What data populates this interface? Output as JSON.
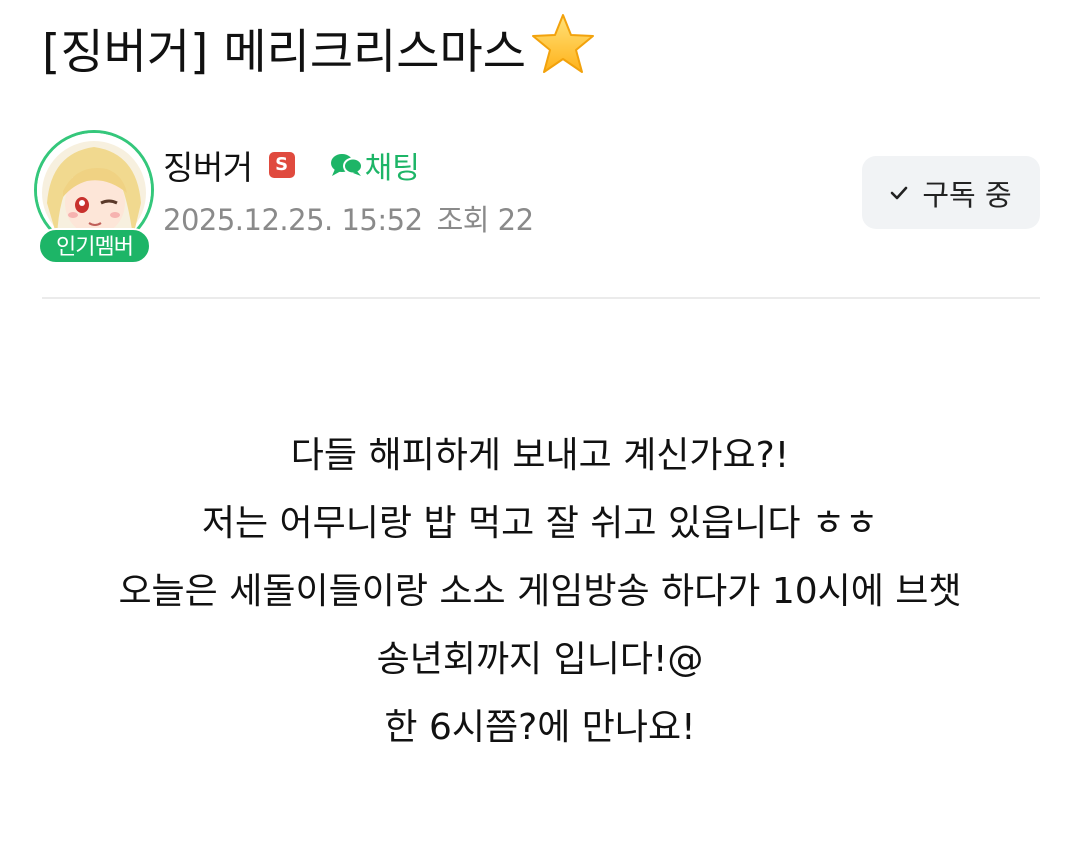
{
  "post": {
    "title": "[징버거] 메리크리스마스",
    "author": {
      "name": "징버거",
      "badge": "인기멤버",
      "level_icon": "S",
      "chat_label": "채팅"
    },
    "date": "2025.12.25. 15:52",
    "views": "조회 22",
    "subscribe_label": "구독 중",
    "body_lines": [
      "다들 해피하게 보내고 계신가요?!",
      "저는 어무니랑 밥 먹고 잘 쉬고 있읍니다 ㅎㅎ",
      "오늘은 세돌이들이랑 소소 게임방송 하다가 10시에 브챗",
      "송년회까지 입니다!@",
      "한 6시쯤?에 만나요!"
    ]
  },
  "colors": {
    "accent_green": "#1db567",
    "level_red": "#e04a3e",
    "meta_gray": "#8a8a8a",
    "star_yellow": "#ffc83d"
  },
  "icons": [
    "star-icon",
    "s-level-icon",
    "chat-bubble-icon",
    "check-icon"
  ]
}
